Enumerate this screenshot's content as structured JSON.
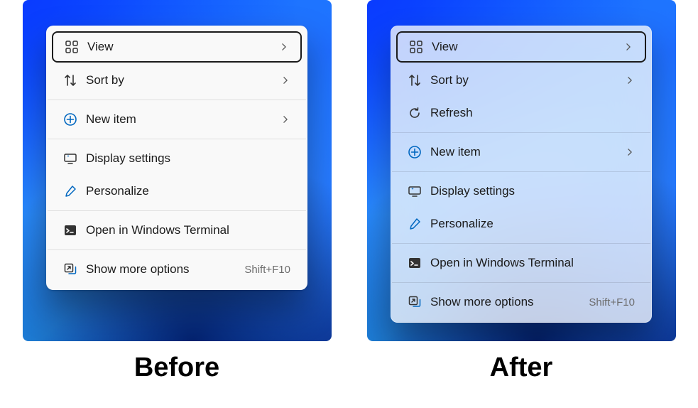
{
  "captions": {
    "before": "Before",
    "after": "After"
  },
  "shortcuts": {
    "show_more": "Shift+F10"
  },
  "before_menu": {
    "items": [
      {
        "label": "View",
        "has_submenu": true,
        "focused": true,
        "icon": "grid"
      },
      {
        "label": "Sort by",
        "has_submenu": true,
        "focused": false,
        "icon": "sort"
      },
      {
        "separator": true
      },
      {
        "label": "New item",
        "has_submenu": true,
        "focused": false,
        "icon": "newitem"
      },
      {
        "separator": true
      },
      {
        "label": "Display settings",
        "has_submenu": false,
        "focused": false,
        "icon": "display"
      },
      {
        "label": "Personalize",
        "has_submenu": false,
        "focused": false,
        "icon": "brush"
      },
      {
        "separator": true
      },
      {
        "label": "Open in Windows Terminal",
        "has_submenu": false,
        "focused": false,
        "icon": "terminal"
      },
      {
        "separator": true
      },
      {
        "label": "Show more options",
        "has_submenu": false,
        "focused": false,
        "icon": "showmore",
        "shortcut_key": "show_more"
      }
    ]
  },
  "after_menu": {
    "items": [
      {
        "label": "View",
        "has_submenu": true,
        "focused": true,
        "icon": "grid"
      },
      {
        "label": "Sort by",
        "has_submenu": true,
        "focused": false,
        "icon": "sort"
      },
      {
        "label": "Refresh",
        "has_submenu": false,
        "focused": false,
        "icon": "refresh"
      },
      {
        "separator": true
      },
      {
        "label": "New item",
        "has_submenu": true,
        "focused": false,
        "icon": "newitem"
      },
      {
        "separator": true
      },
      {
        "label": "Display settings",
        "has_submenu": false,
        "focused": false,
        "icon": "display"
      },
      {
        "label": "Personalize",
        "has_submenu": false,
        "focused": false,
        "icon": "brush"
      },
      {
        "separator": true
      },
      {
        "label": "Open in Windows Terminal",
        "has_submenu": false,
        "focused": false,
        "icon": "terminal"
      },
      {
        "separator": true
      },
      {
        "label": "Show more options",
        "has_submenu": false,
        "focused": false,
        "icon": "showmore",
        "shortcut_key": "show_more"
      }
    ]
  }
}
